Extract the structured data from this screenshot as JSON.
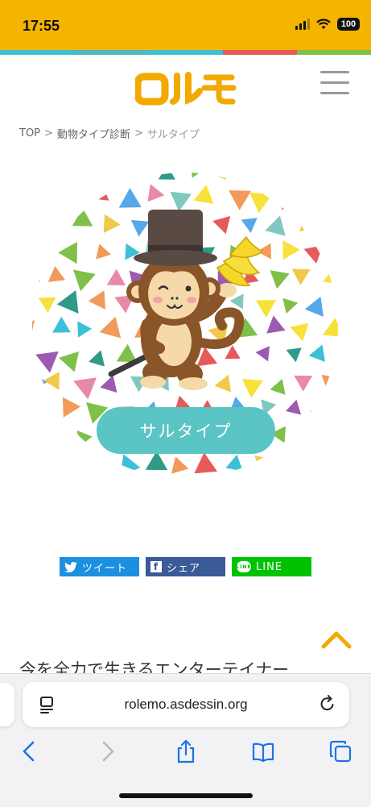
{
  "status_bar": {
    "time": "17:55",
    "battery": "100",
    "icons": [
      "signal-icon",
      "wifi-icon",
      "battery-icon"
    ],
    "background": "#f5b400"
  },
  "color_strip": [
    "#3cc0d8",
    "#4bb8c8",
    "#3cc0d8",
    "#e85a5a",
    "#7fc04a"
  ],
  "header": {
    "logo_text": "ロルモ",
    "logo_color": "#f2a900",
    "menu_icon": "hamburger-icon"
  },
  "breadcrumb": {
    "items": [
      "TOP",
      "動物タイプ診断",
      "サルタイプ"
    ],
    "separator": ">"
  },
  "hero": {
    "type_label": "サルタイプ",
    "pill_color": "#5bc4c5",
    "illustration": "monkey-with-top-hat-and-banana"
  },
  "share": {
    "twitter_label": "ツイート",
    "facebook_label": "シェア",
    "line_label": "LINE",
    "twitter_color": "#1d8fe0",
    "facebook_color": "#3a5a98",
    "line_color": "#00c300"
  },
  "content": {
    "heading": "今を全力で生きるエンターテイナー"
  },
  "browser": {
    "url": "rolemo.asdessin.org",
    "toolbar_icons": [
      "back-icon",
      "forward-icon",
      "share-icon",
      "bookmarks-icon",
      "tabs-icon"
    ]
  }
}
